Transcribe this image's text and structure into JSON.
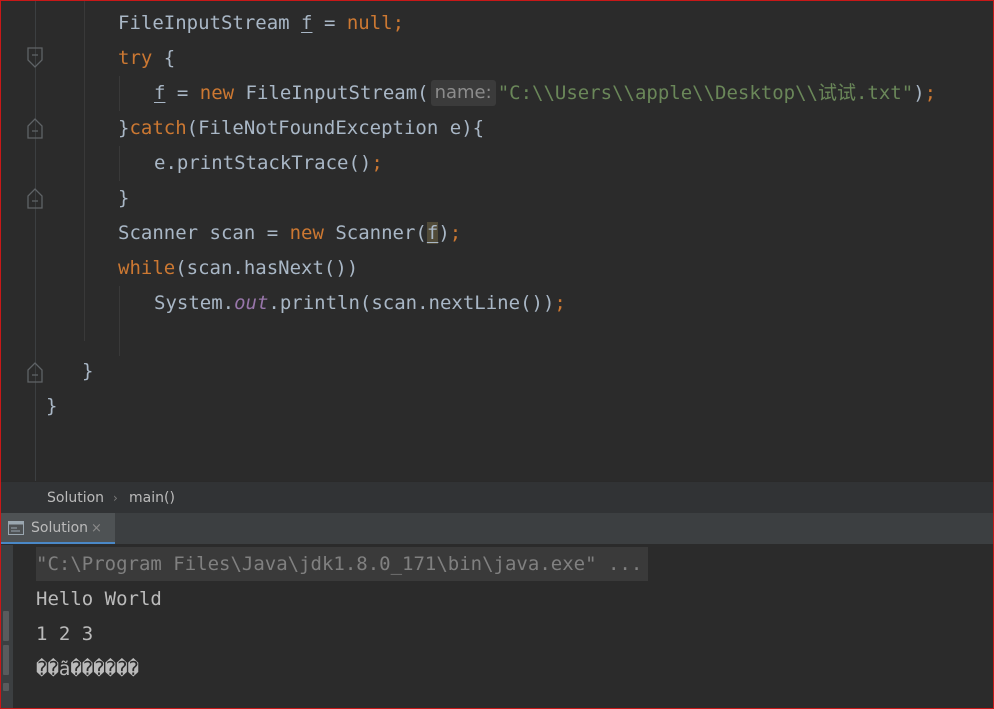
{
  "editor": {
    "line1": {
      "type": "FileInputStream",
      "var": "f",
      "eq": " = ",
      "null_kw": "null",
      "semi": ";"
    },
    "line2": {
      "try_kw": "try",
      "brace": " {"
    },
    "line3": {
      "var": "f",
      "eq": " = ",
      "new_kw": "new",
      "ctor": " FileInputStream(",
      "hint": "name:",
      "path": "\"C:\\\\Users\\\\apple\\\\Desktop\\\\试试.txt\"",
      "close": ")",
      "semi": ";"
    },
    "line4": {
      "brace": "}",
      "catch_kw": "catch",
      "rest": "(FileNotFoundException e){"
    },
    "line5": {
      "call": "e.printStackTrace()",
      "semi": ";"
    },
    "line6": {
      "brace": "}"
    },
    "line7": {
      "decl": "Scanner scan = ",
      "new_kw": "new",
      "ctor": " Scanner(",
      "arg": "f",
      "close": ")",
      "semi": ";"
    },
    "line8": {
      "while_kw": "while",
      "cond": "(scan.hasNext())"
    },
    "line9": {
      "sys": "System.",
      "out": "out",
      "rest": ".println(scan.nextLine())",
      "semi": ";"
    },
    "line11": {
      "brace": "}"
    },
    "line12": {
      "brace": "}"
    }
  },
  "breadcrumb": {
    "items": [
      "Solution",
      "main()"
    ],
    "separator": "›"
  },
  "run_panel": {
    "tab_label": "Solution",
    "tab_close": "×",
    "tab_icon": "console-icon"
  },
  "console": {
    "command": "\"C:\\Program Files\\Java\\jdk1.8.0_171\\bin\\java.exe\" ...",
    "lines": [
      "Hello World",
      "1 2 3",
      "��ã������"
    ]
  },
  "colors": {
    "background": "#2b2b2b",
    "keyword": "#cc7832",
    "string": "#6a8759",
    "static_field": "#9876aa",
    "default_text": "#a9b7c6",
    "window_border": "#c81818"
  }
}
